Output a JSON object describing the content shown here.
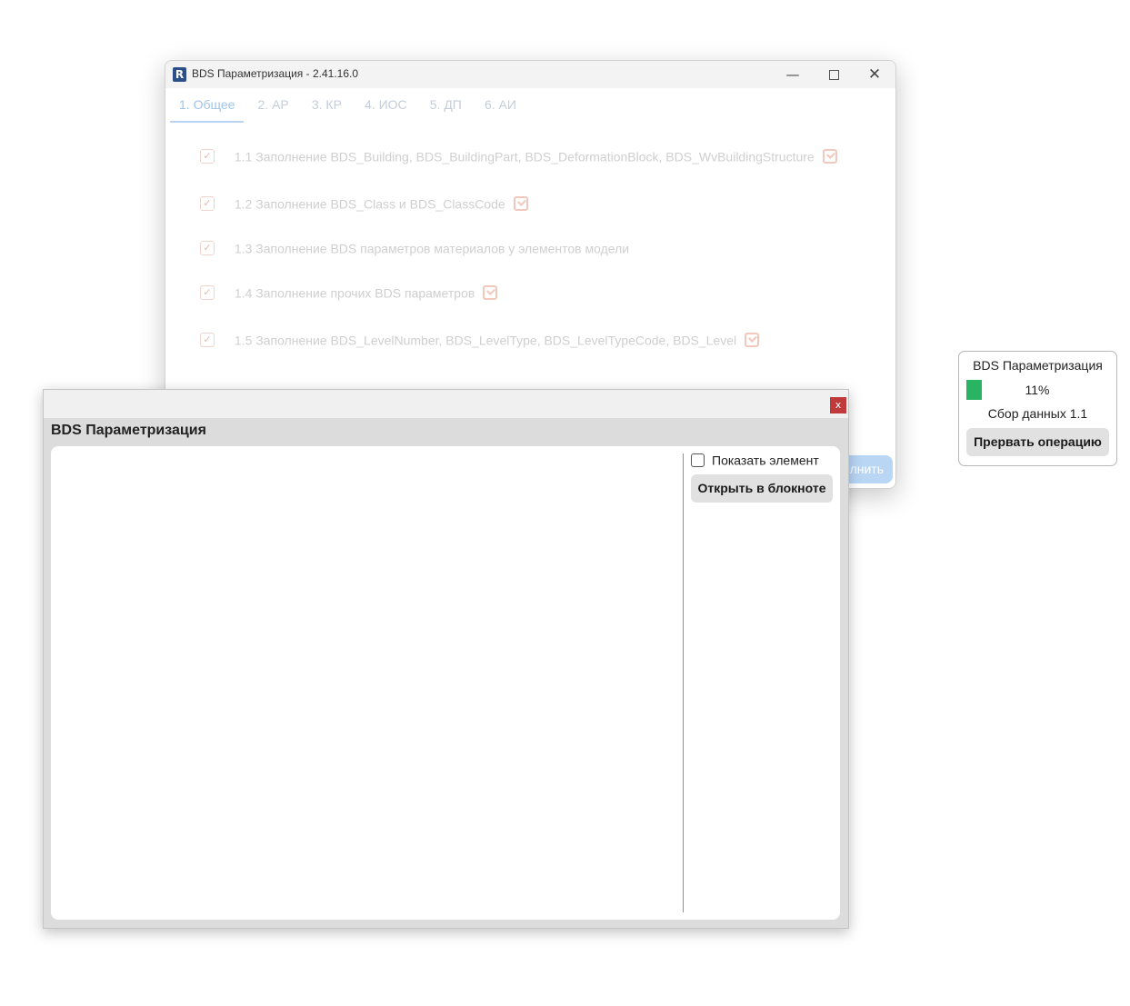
{
  "main_window": {
    "title": "BDS Параметризация - 2.41.16.0",
    "app_icon_letter": "R",
    "controls": {
      "minimize": "—",
      "close": "✕"
    },
    "tabs": [
      {
        "label": "1. Общее",
        "active": true
      },
      {
        "label": "2. АР",
        "active": false
      },
      {
        "label": "3. КР",
        "active": false
      },
      {
        "label": "4. ИОС",
        "active": false
      },
      {
        "label": "5. ДП",
        "active": false
      },
      {
        "label": "6. АИ",
        "active": false
      }
    ],
    "options": [
      {
        "label": "1.1 Заполнение BDS_Building, BDS_BuildingPart, BDS_DeformationBlock, BDS_WvBuildingStructure",
        "checked": true,
        "has_icon": true
      },
      {
        "label": "1.2 Заполнение BDS_Class и BDS_ClassCode",
        "checked": true,
        "has_icon": true
      },
      {
        "label": "1.3 Заполнение BDS параметров материалов у элементов модели",
        "checked": true,
        "has_icon": false
      },
      {
        "label": "1.4 Заполнение прочих BDS параметров",
        "checked": true,
        "has_icon": true
      },
      {
        "label": "1.5 Заполнение BDS_LevelNumber, BDS_LevelType, BDS_LevelTypeCode, BDS_Level",
        "checked": true,
        "has_icon": true
      }
    ],
    "run_button_visible_text": "лнить",
    "check_glyph": "✓"
  },
  "log_window": {
    "title": "BDS Параметризация",
    "close_label": "x",
    "show_element_label": "Показать элемент",
    "show_element_checked": false,
    "open_notepad_label": "Открыть в блокноте"
  },
  "progress_window": {
    "title": "BDS Параметризация",
    "percent": 11,
    "percent_label": "11%",
    "status": "Сбор данных 1.1",
    "abort_label": "Прервать операцию",
    "bar_color": "#28b463"
  },
  "colors": {
    "tab_active": "#9ec4ea",
    "close_button": "#c0393b",
    "run_button": "#b9d7f5"
  }
}
